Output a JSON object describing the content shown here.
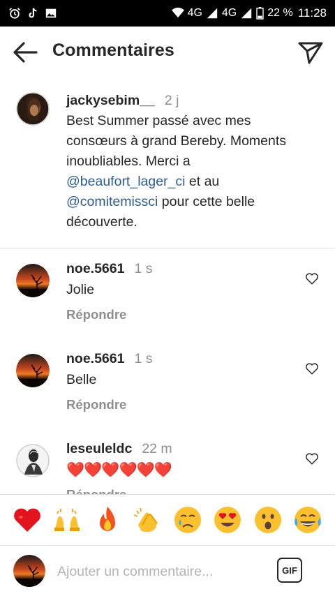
{
  "status_bar": {
    "network_1": "4G",
    "network_2": "4G",
    "battery": "22 %",
    "time": "11:28",
    "icons": [
      "alarm-icon",
      "tiktok-icon",
      "gallery-icon",
      "wifi-icon",
      "signal-icon",
      "battery-icon"
    ]
  },
  "header": {
    "title": "Commentaires",
    "back_icon": "arrow-left-icon",
    "send_icon": "paper-plane-icon"
  },
  "caption": {
    "username": "jackysebim__",
    "time": "2 j",
    "text_1": "Best Summer passé avec mes consœurs à grand Bereby. Moments inoubliables. Merci a ",
    "mention_1": "@beaufort_lager_ci",
    "text_2": " et au ",
    "mention_2": "@comitemissci",
    "text_3": " pour cette belle découverte."
  },
  "comments": [
    {
      "username": "noe.5661",
      "time": "1 s",
      "text": "Jolie",
      "reply": "Répondre"
    },
    {
      "username": "noe.5661",
      "time": "1 s",
      "text": "Belle",
      "reply": "Répondre"
    },
    {
      "username": "leseuleldc",
      "time": "22 m",
      "text": "❤️❤️❤️❤️❤️❤️",
      "reply": "Répondre"
    }
  ],
  "emoji_bar": [
    "heart",
    "raising-hands",
    "fire",
    "clapping-hands",
    "crying-face",
    "heart-eyes-face",
    "surprised-face",
    "tears-of-joy-face"
  ],
  "input": {
    "placeholder": "Ajouter un commentaire...",
    "gif_label": "GIF"
  },
  "colors": {
    "text": "#262626",
    "muted": "#8e8e8e",
    "mention": "#2f5b8f",
    "divider": "#dbdbdb"
  }
}
